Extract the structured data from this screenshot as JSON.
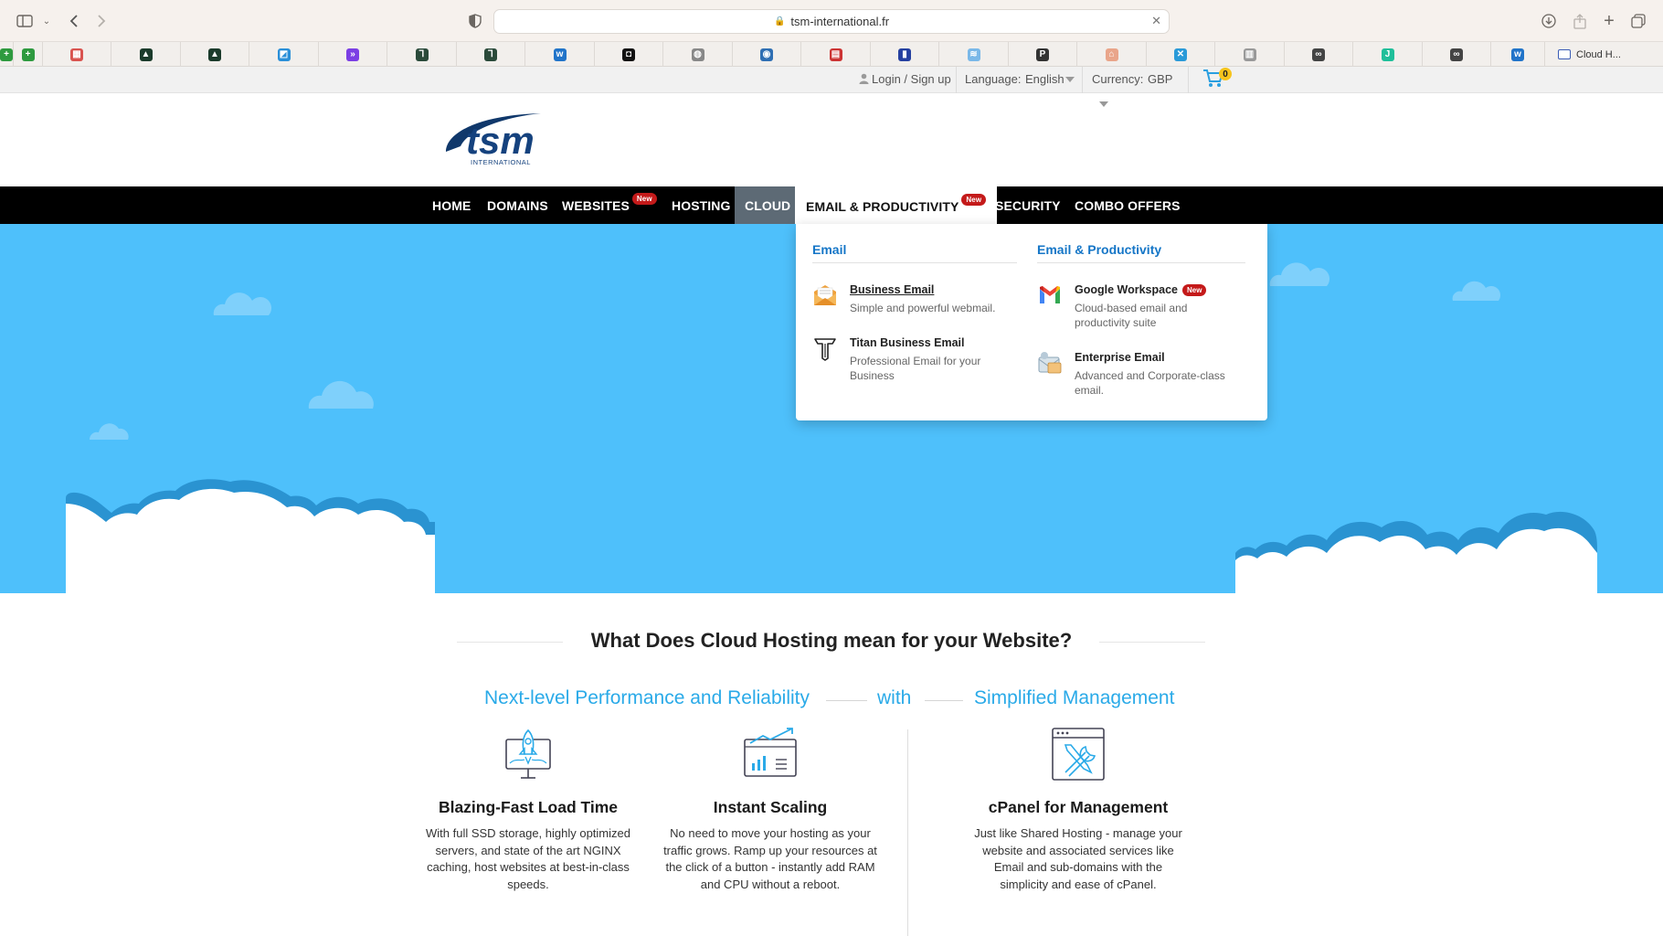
{
  "browser": {
    "url": "tsm-international.fr",
    "last_tab_label": "Cloud H..."
  },
  "bookmarks": [
    {
      "icon": "green-plus-icon",
      "glyph": "+",
      "color": "#2e9a3f"
    },
    {
      "icon": "green-plus-icon",
      "glyph": "+",
      "color": "#2e9a3f"
    },
    {
      "icon": "colorful-tile-icon",
      "glyph": "▦",
      "color": "#d9534f"
    },
    {
      "icon": "dark-triangle-icon",
      "glyph": "▲",
      "color": "#1b3b2b"
    },
    {
      "icon": "dark-triangle-icon",
      "glyph": "▲",
      "color": "#1b3b2b"
    },
    {
      "icon": "blue-flag-icon",
      "glyph": "◩",
      "color": "#2a8fd8"
    },
    {
      "icon": "purple-arrows-icon",
      "glyph": "»",
      "color": "#7b3fe4"
    },
    {
      "icon": "stylized-t-icon",
      "glyph": "Ꞁ",
      "color": "#2a4a3a"
    },
    {
      "icon": "stylized-t-icon",
      "glyph": "Ꞁ",
      "color": "#2a4a3a"
    },
    {
      "icon": "blue-w-icon",
      "glyph": "w",
      "color": "#2174c9"
    },
    {
      "icon": "black-square-icon",
      "glyph": "◘",
      "color": "#111111"
    },
    {
      "icon": "gray-globe-icon",
      "glyph": "◍",
      "color": "#888888"
    },
    {
      "icon": "blue-globe-icon",
      "glyph": "◉",
      "color": "#2f6fb3"
    },
    {
      "icon": "flag-icon",
      "glyph": "▤",
      "color": "#c33"
    },
    {
      "icon": "french-flag-icon",
      "glyph": "▮",
      "color": "#2540a0"
    },
    {
      "icon": "light-blue-wave-icon",
      "glyph": "≋",
      "color": "#7ab8e8"
    },
    {
      "icon": "letter-p-icon",
      "glyph": "P",
      "color": "#333333"
    },
    {
      "icon": "peach-house-icon",
      "glyph": "⌂",
      "color": "#e9a58a"
    },
    {
      "icon": "blue-cross-icon",
      "glyph": "✕",
      "color": "#2a9ad8"
    },
    {
      "icon": "gray-book-icon",
      "glyph": "▥",
      "color": "#999999"
    },
    {
      "icon": "glasses-icon",
      "glyph": "∞",
      "color": "#444444"
    },
    {
      "icon": "teal-j-icon",
      "glyph": "J",
      "color": "#1fbf9a"
    },
    {
      "icon": "glasses-icon",
      "glyph": "∞",
      "color": "#444444"
    },
    {
      "icon": "blue-w-icon",
      "glyph": "w",
      "color": "#2174c9"
    }
  ],
  "topbar": {
    "login": "Login / Sign up",
    "language_label": "Language:",
    "language_value": "English",
    "currency_label": "Currency:",
    "currency_value": "GBP",
    "cart_count": "0"
  },
  "nav": {
    "home": "HOME",
    "domains": "DOMAINS",
    "websites": "WEBSITES",
    "hosting": "HOSTING",
    "cloud": "CLOUD",
    "email": "EMAIL & PRODUCTIVITY",
    "security": "SECURITY",
    "combo": "COMBO OFFERS",
    "new_badge": "New"
  },
  "dropdown": {
    "col1_title": "Email",
    "col2_title": "Email & Productivity",
    "business_email": {
      "title": "Business Email",
      "desc": "Simple and powerful webmail."
    },
    "titan_email": {
      "title": "Titan Business Email",
      "desc": "Professional Email for your Business"
    },
    "google_workspace": {
      "title": "Google Workspace",
      "desc": "Cloud-based email and productivity suite"
    },
    "enterprise_email": {
      "title": "Enterprise Email",
      "desc": "Advanced and Corporate-class email."
    }
  },
  "content": {
    "heading": "What Does Cloud Hosting mean for your Website?",
    "sub_left": "Next-level Performance and Reliability",
    "sub_mid": "with",
    "sub_right": "Simplified Management",
    "features": [
      {
        "title": "Blazing-Fast Load Time",
        "desc": "With full SSD storage, highly optimized servers, and state of the art NGINX caching, host websites at best-in-class speeds."
      },
      {
        "title": "Instant Scaling",
        "desc": "No need to move your hosting as your traffic grows. Ramp up your resources at the click of a button - instantly add RAM and CPU without a reboot."
      },
      {
        "title": "cPanel for Management",
        "desc": "Just like Shared Hosting - manage your website and associated services like Email and sub-domains with the simplicity and ease of cPanel."
      }
    ]
  },
  "colors": {
    "hero_sky": "#4ec0fb",
    "accent_blue": "#2aaae8",
    "nav_bg": "#000000",
    "badge_red": "#c41a1a"
  }
}
